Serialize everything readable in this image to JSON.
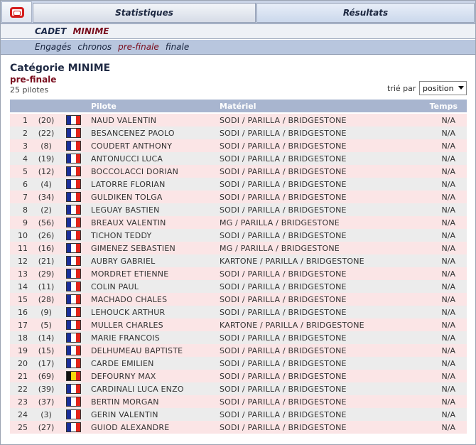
{
  "nav": {
    "logo": "logo-icon",
    "tabs": [
      {
        "label": "Statistiques",
        "active": false
      },
      {
        "label": "Résultats",
        "active": true
      }
    ],
    "sub1": {
      "cadet": "CADET",
      "minime": "MINIME"
    },
    "sub2": [
      {
        "label": "Engagés",
        "active": false
      },
      {
        "label": "chronos",
        "active": false
      },
      {
        "label": "pre-finale",
        "active": true
      },
      {
        "label": "finale",
        "active": false
      }
    ]
  },
  "header": {
    "title": "Catégorie MINIME",
    "session": "pre-finale",
    "count": "25 pilotes",
    "sort_label": "trié par",
    "sort_value": "position"
  },
  "table": {
    "columns": {
      "pilote": "Pilote",
      "materiel": "Matériel",
      "temps": "Temps"
    },
    "flag_colors": {
      "fr": [
        "#1a2f9a",
        "#ffffff",
        "#e2231a"
      ],
      "be": [
        "#111111",
        "#f6d80b",
        "#e2231a"
      ]
    },
    "rows": [
      {
        "pos": "1",
        "num": "(20)",
        "flag": "fr",
        "pilote": "NAUD VALENTIN",
        "materiel": "SODI / PARILLA / BRIDGESTONE",
        "temps": "N/A"
      },
      {
        "pos": "2",
        "num": "(22)",
        "flag": "fr",
        "pilote": "BESANCENEZ PAOLO",
        "materiel": "SODI / PARILLA / BRIDGESTONE",
        "temps": "N/A"
      },
      {
        "pos": "3",
        "num": "(8)",
        "flag": "fr",
        "pilote": "COUDERT ANTHONY",
        "materiel": "SODI / PARILLA / BRIDGESTONE",
        "temps": "N/A"
      },
      {
        "pos": "4",
        "num": "(19)",
        "flag": "fr",
        "pilote": "ANTONUCCI LUCA",
        "materiel": "SODI / PARILLA / BRIDGESTONE",
        "temps": "N/A"
      },
      {
        "pos": "5",
        "num": "(12)",
        "flag": "fr",
        "pilote": "BOCCOLACCI DORIAN",
        "materiel": "SODI / PARILLA / BRIDGESTONE",
        "temps": "N/A"
      },
      {
        "pos": "6",
        "num": "(4)",
        "flag": "fr",
        "pilote": "LATORRE FLORIAN",
        "materiel": "SODI / PARILLA / BRIDGESTONE",
        "temps": "N/A"
      },
      {
        "pos": "7",
        "num": "(34)",
        "flag": "fr",
        "pilote": "GULDIKEN TOLGA",
        "materiel": "SODI / PARILLA / BRIDGESTONE",
        "temps": "N/A"
      },
      {
        "pos": "8",
        "num": "(2)",
        "flag": "fr",
        "pilote": "LEGUAY BASTIEN",
        "materiel": "SODI / PARILLA / BRIDGESTONE",
        "temps": "N/A"
      },
      {
        "pos": "9",
        "num": "(56)",
        "flag": "fr",
        "pilote": "BREAUX VALENTIN",
        "materiel": "MG / PARILLA / BRIDGESTONE",
        "temps": "N/A"
      },
      {
        "pos": "10",
        "num": "(26)",
        "flag": "fr",
        "pilote": "TICHON TEDDY",
        "materiel": "SODI / PARILLA / BRIDGESTONE",
        "temps": "N/A"
      },
      {
        "pos": "11",
        "num": "(16)",
        "flag": "fr",
        "pilote": "GIMENEZ SEBASTIEN",
        "materiel": "MG / PARILLA / BRIDGESTONE",
        "temps": "N/A"
      },
      {
        "pos": "12",
        "num": "(21)",
        "flag": "fr",
        "pilote": "AUBRY GABRIEL",
        "materiel": "KARTONE / PARILLA / BRIDGESTONE",
        "temps": "N/A"
      },
      {
        "pos": "13",
        "num": "(29)",
        "flag": "fr",
        "pilote": "MORDRET ETIENNE",
        "materiel": "SODI / PARILLA / BRIDGESTONE",
        "temps": "N/A"
      },
      {
        "pos": "14",
        "num": "(11)",
        "flag": "fr",
        "pilote": "COLIN PAUL",
        "materiel": "SODI / PARILLA / BRIDGESTONE",
        "temps": "N/A"
      },
      {
        "pos": "15",
        "num": "(28)",
        "flag": "fr",
        "pilote": "MACHADO CHALES",
        "materiel": "SODI / PARILLA / BRIDGESTONE",
        "temps": "N/A"
      },
      {
        "pos": "16",
        "num": "(9)",
        "flag": "fr",
        "pilote": "LEHOUCK ARTHUR",
        "materiel": "SODI / PARILLA / BRIDGESTONE",
        "temps": "N/A"
      },
      {
        "pos": "17",
        "num": "(5)",
        "flag": "fr",
        "pilote": "MULLER CHARLES",
        "materiel": "KARTONE / PARILLA / BRIDGESTONE",
        "temps": "N/A"
      },
      {
        "pos": "18",
        "num": "(14)",
        "flag": "fr",
        "pilote": "MARIE FRANCOIS",
        "materiel": "SODI / PARILLA / BRIDGESTONE",
        "temps": "N/A"
      },
      {
        "pos": "19",
        "num": "(15)",
        "flag": "fr",
        "pilote": "DELHUMEAU BAPTISTE",
        "materiel": "SODI / PARILLA / BRIDGESTONE",
        "temps": "N/A"
      },
      {
        "pos": "20",
        "num": "(17)",
        "flag": "fr",
        "pilote": "CARDE EMILIEN",
        "materiel": "SODI / PARILLA / BRIDGESTONE",
        "temps": "N/A"
      },
      {
        "pos": "21",
        "num": "(69)",
        "flag": "be",
        "pilote": "DEFOURNY MAX",
        "materiel": "SODI / PARILLA / BRIDGESTONE",
        "temps": "N/A"
      },
      {
        "pos": "22",
        "num": "(39)",
        "flag": "fr",
        "pilote": "CARDINALI LUCA ENZO",
        "materiel": "SODI / PARILLA / BRIDGESTONE",
        "temps": "N/A"
      },
      {
        "pos": "23",
        "num": "(37)",
        "flag": "fr",
        "pilote": "BERTIN MORGAN",
        "materiel": "SODI / PARILLA / BRIDGESTONE",
        "temps": "N/A"
      },
      {
        "pos": "24",
        "num": "(3)",
        "flag": "fr",
        "pilote": "GERIN VALENTIN",
        "materiel": "SODI / PARILLA / BRIDGESTONE",
        "temps": "N/A"
      },
      {
        "pos": "25",
        "num": "(27)",
        "flag": "fr",
        "pilote": "GUIOD ALEXANDRE",
        "materiel": "SODI / PARILLA / BRIDGESTONE",
        "temps": "N/A"
      }
    ]
  }
}
